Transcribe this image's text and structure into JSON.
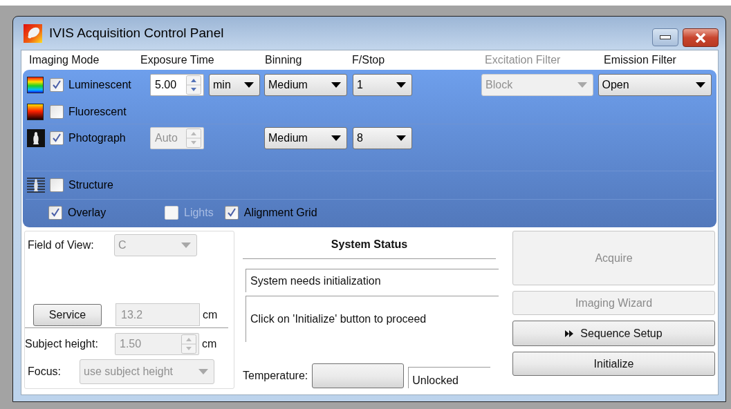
{
  "window": {
    "title": "IVIS Acquisition Control Panel"
  },
  "column_headers": [
    {
      "label": "Imaging Mode",
      "disabled": false
    },
    {
      "label": "Exposure Time",
      "disabled": false
    },
    {
      "label": "Binning",
      "disabled": false
    },
    {
      "label": "F/Stop",
      "disabled": false
    },
    {
      "label": "Excitation Filter",
      "disabled": true
    },
    {
      "label": "Emission Filter",
      "disabled": false
    }
  ],
  "imaging_modes": [
    {
      "kind": "luminescent",
      "label": "Luminescent",
      "checked": true,
      "exposure": {
        "value": "5.00",
        "disabled": false
      },
      "unit": "min",
      "binning": "Medium",
      "fstop": "1",
      "excitation_filter": {
        "value": "Block",
        "disabled": true
      },
      "emission_filter": "Open"
    },
    {
      "kind": "fluorescent",
      "label": "Fluorescent",
      "checked": false
    },
    {
      "kind": "photograph",
      "label": "Photograph",
      "checked": true,
      "exposure": {
        "value": "Auto",
        "disabled": true
      },
      "binning": "Medium",
      "fstop": "8"
    },
    {
      "kind": "structure",
      "label": "Structure",
      "checked": false
    }
  ],
  "overlay_options": [
    {
      "label": "Overlay",
      "checked": true,
      "disabled": false
    },
    {
      "label": "Lights",
      "checked": false,
      "disabled": true
    },
    {
      "label": "Alignment Grid",
      "checked": true,
      "disabled": false
    }
  ],
  "field_of_view": {
    "label": "Field of View:",
    "value": "C",
    "disabled": true
  },
  "service_button": {
    "label": "Service"
  },
  "stage_height": {
    "value": "13.2",
    "unit": "cm",
    "disabled": true
  },
  "subject_height": {
    "label": "Subject height:",
    "value": "1.50",
    "unit": "cm",
    "disabled": true
  },
  "focus": {
    "label": "Focus:",
    "value": "use subject height",
    "disabled": true
  },
  "system_status": {
    "title": "System Status",
    "message": "System needs initialization",
    "detail": "Click on 'Initialize' button to proceed",
    "temperature_label": "Temperature:",
    "lock_state": "Unlocked"
  },
  "buttons": [
    {
      "kind": "large",
      "label": "Acquire",
      "disabled": true
    },
    {
      "kind": "plain",
      "label": "Imaging Wizard",
      "disabled": true
    },
    {
      "kind": "sequence",
      "label": "Sequence Setup",
      "disabled": false
    },
    {
      "kind": "plain",
      "label": "Initialize",
      "disabled": false
    }
  ]
}
